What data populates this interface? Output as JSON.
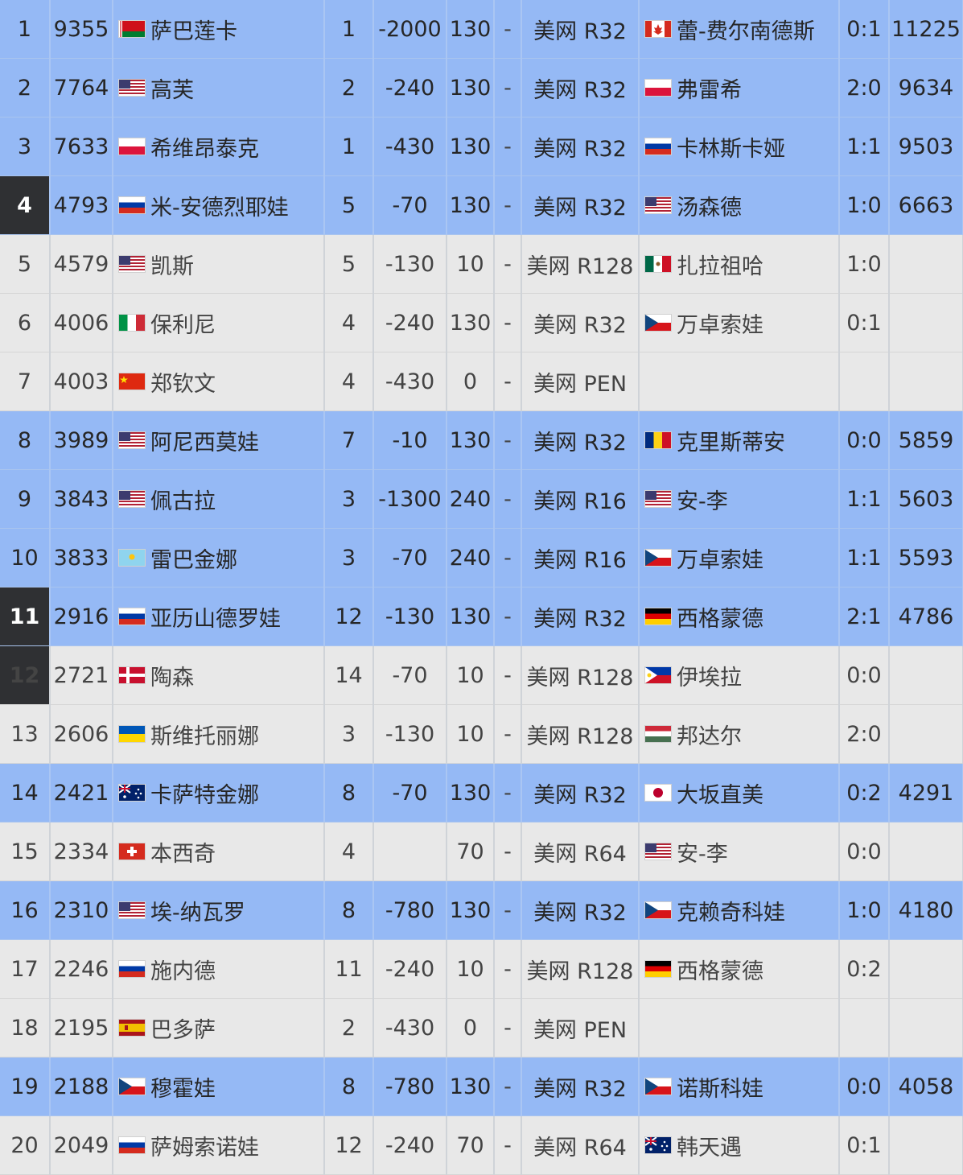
{
  "rows": [
    {
      "rank": "1",
      "points": "9355",
      "flag": "BLR",
      "name": "萨巴莲卡",
      "seed": "1",
      "change": "-2000",
      "pts": "130",
      "dash": "-",
      "round": "美网 R32",
      "opp_flag": "CAN",
      "opponent": "蕾-费尔南德斯",
      "h2h": "0:1",
      "final": "11225",
      "hl": true,
      "dark": false
    },
    {
      "rank": "2",
      "points": "7764",
      "flag": "USA",
      "name": "高芙",
      "seed": "2",
      "change": "-240",
      "pts": "130",
      "dash": "-",
      "round": "美网 R32",
      "opp_flag": "POL",
      "opponent": "弗雷希",
      "h2h": "2:0",
      "final": "9634",
      "hl": true,
      "dark": false
    },
    {
      "rank": "3",
      "points": "7633",
      "flag": "POL",
      "name": "希维昂泰克",
      "seed": "1",
      "change": "-430",
      "pts": "130",
      "dash": "-",
      "round": "美网 R32",
      "opp_flag": "RUS",
      "opponent": "卡林斯卡娅",
      "h2h": "1:1",
      "final": "9503",
      "hl": true,
      "dark": false
    },
    {
      "rank": "4",
      "points": "4793",
      "flag": "RUS",
      "name": "米-安德烈耶娃",
      "seed": "5",
      "change": "-70",
      "pts": "130",
      "dash": "-",
      "round": "美网 R32",
      "opp_flag": "USA",
      "opponent": "汤森德",
      "h2h": "1:0",
      "final": "6663",
      "hl": true,
      "dark": true
    },
    {
      "rank": "5",
      "points": "4579",
      "flag": "USA",
      "name": "凯斯",
      "seed": "5",
      "change": "-130",
      "pts": "10",
      "dash": "-",
      "round": "美网 R128",
      "opp_flag": "MEX",
      "opponent": "扎拉祖哈",
      "h2h": "1:0",
      "final": "",
      "hl": false,
      "dark": false
    },
    {
      "rank": "6",
      "points": "4006",
      "flag": "ITA",
      "name": "保利尼",
      "seed": "4",
      "change": "-240",
      "pts": "130",
      "dash": "-",
      "round": "美网 R32",
      "opp_flag": "CZE",
      "opponent": "万卓索娃",
      "h2h": "0:1",
      "final": "",
      "hl": false,
      "dark": false
    },
    {
      "rank": "7",
      "points": "4003",
      "flag": "CHN",
      "name": "郑钦文",
      "seed": "4",
      "change": "-430",
      "pts": "0",
      "dash": "-",
      "round": "美网 PEN",
      "opp_flag": "",
      "opponent": "",
      "h2h": "",
      "final": "",
      "hl": false,
      "dark": false
    },
    {
      "rank": "8",
      "points": "3989",
      "flag": "USA",
      "name": "阿尼西莫娃",
      "seed": "7",
      "change": "-10",
      "pts": "130",
      "dash": "-",
      "round": "美网 R32",
      "opp_flag": "ROU",
      "opponent": "克里斯蒂安",
      "h2h": "0:0",
      "final": "5859",
      "hl": true,
      "dark": false
    },
    {
      "rank": "9",
      "points": "3843",
      "flag": "USA",
      "name": "佩古拉",
      "seed": "3",
      "change": "-1300",
      "pts": "240",
      "dash": "-",
      "round": "美网 R16",
      "opp_flag": "USA",
      "opponent": "安-李",
      "h2h": "1:1",
      "final": "5603",
      "hl": true,
      "dark": false
    },
    {
      "rank": "10",
      "points": "3833",
      "flag": "KAZ",
      "name": "雷巴金娜",
      "seed": "3",
      "change": "-70",
      "pts": "240",
      "dash": "-",
      "round": "美网 R16",
      "opp_flag": "CZE",
      "opponent": "万卓索娃",
      "h2h": "1:1",
      "final": "5593",
      "hl": true,
      "dark": false
    },
    {
      "rank": "11",
      "points": "2916",
      "flag": "RUS",
      "name": "亚历山德罗娃",
      "seed": "12",
      "change": "-130",
      "pts": "130",
      "dash": "-",
      "round": "美网 R32",
      "opp_flag": "GER",
      "opponent": "西格蒙德",
      "h2h": "2:1",
      "final": "4786",
      "hl": true,
      "dark": true
    },
    {
      "rank": "12",
      "points": "2721",
      "flag": "DEN",
      "name": "陶森",
      "seed": "14",
      "change": "-70",
      "pts": "10",
      "dash": "-",
      "round": "美网 R128",
      "opp_flag": "PHI",
      "opponent": "伊埃拉",
      "h2h": "0:0",
      "final": "",
      "hl": false,
      "dark": true
    },
    {
      "rank": "13",
      "points": "2606",
      "flag": "UKR",
      "name": "斯维托丽娜",
      "seed": "3",
      "change": "-130",
      "pts": "10",
      "dash": "-",
      "round": "美网 R128",
      "opp_flag": "HUN",
      "opponent": "邦达尔",
      "h2h": "2:0",
      "final": "",
      "hl": false,
      "dark": false
    },
    {
      "rank": "14",
      "points": "2421",
      "flag": "AUS",
      "name": "卡萨特金娜",
      "seed": "8",
      "change": "-70",
      "pts": "130",
      "dash": "-",
      "round": "美网 R32",
      "opp_flag": "JPN",
      "opponent": "大坂直美",
      "h2h": "0:2",
      "final": "4291",
      "hl": true,
      "dark": false
    },
    {
      "rank": "15",
      "points": "2334",
      "flag": "SUI",
      "name": "本西奇",
      "seed": "4",
      "change": "",
      "pts": "70",
      "dash": "-",
      "round": "美网 R64",
      "opp_flag": "USA",
      "opponent": "安-李",
      "h2h": "0:0",
      "final": "",
      "hl": false,
      "dark": false
    },
    {
      "rank": "16",
      "points": "2310",
      "flag": "USA",
      "name": "埃-纳瓦罗",
      "seed": "8",
      "change": "-780",
      "pts": "130",
      "dash": "-",
      "round": "美网 R32",
      "opp_flag": "CZE",
      "opponent": "克赖奇科娃",
      "h2h": "1:0",
      "final": "4180",
      "hl": true,
      "dark": false
    },
    {
      "rank": "17",
      "points": "2246",
      "flag": "RUS",
      "name": "施内德",
      "seed": "11",
      "change": "-240",
      "pts": "10",
      "dash": "-",
      "round": "美网 R128",
      "opp_flag": "GER",
      "opponent": "西格蒙德",
      "h2h": "0:2",
      "final": "",
      "hl": false,
      "dark": false
    },
    {
      "rank": "18",
      "points": "2195",
      "flag": "ESP",
      "name": "巴多萨",
      "seed": "2",
      "change": "-430",
      "pts": "0",
      "dash": "-",
      "round": "美网 PEN",
      "opp_flag": "",
      "opponent": "",
      "h2h": "",
      "final": "",
      "hl": false,
      "dark": false
    },
    {
      "rank": "19",
      "points": "2188",
      "flag": "CZE",
      "name": "穆霍娃",
      "seed": "8",
      "change": "-780",
      "pts": "130",
      "dash": "-",
      "round": "美网 R32",
      "opp_flag": "CZE",
      "opponent": "诺斯科娃",
      "h2h": "0:0",
      "final": "4058",
      "hl": true,
      "dark": false
    },
    {
      "rank": "20",
      "points": "2049",
      "flag": "RUS",
      "name": "萨姆索诺娃",
      "seed": "12",
      "change": "-240",
      "pts": "70",
      "dash": "-",
      "round": "美网 R64",
      "opp_flag": "AUS",
      "opponent": "韩天遇",
      "h2h": "0:1",
      "final": "",
      "hl": false,
      "dark": false
    }
  ],
  "colors": {
    "highlight_row": "#95b9f5",
    "plain_row": "#e8e8e8",
    "dark_rank": "#2f3033"
  }
}
